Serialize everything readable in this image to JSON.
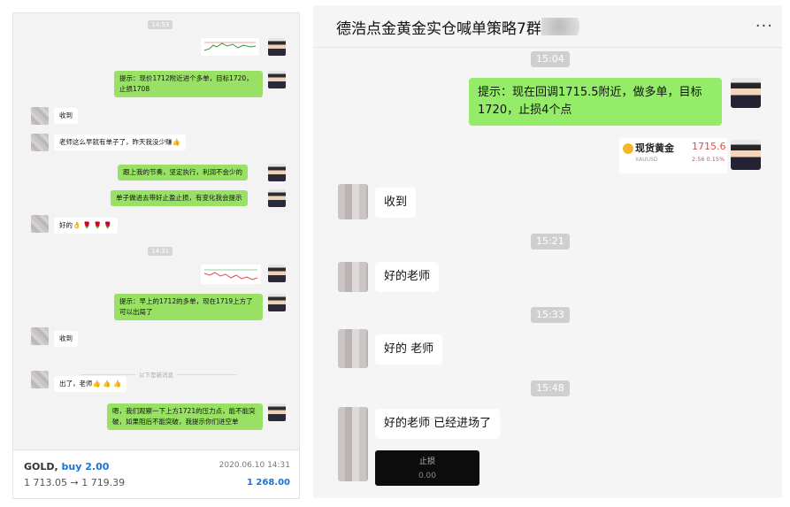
{
  "left_panel": {
    "time_1": "14:53",
    "msg_1": "提示：现价1712附近进个多单，目标1720，止损1708",
    "msg_2": "收到",
    "msg_3": "老师这么早就有单子了，昨天我没少赚👍",
    "msg_4": "跟上我的节奏，坚定执行，利润不会少的",
    "msg_5": "单子做进去带好止盈止损，有变化我会提示",
    "msg_6": "好的👌 🌹 🌹 🌹",
    "time_2": "14:31",
    "msg_7": "提示：早上的1712的多单，现在1719上方了可以出局了",
    "msg_8": "收到",
    "divider": "以下是新消息",
    "msg_9": "出了，老师👍 👍 👍",
    "msg_10": "嗯，我们观察一下上方1721的压力点，能不能突破，如果阻后不能突破，我提示你们进空单"
  },
  "trade_footer": {
    "symbol": "GOLD,",
    "action": "buy 2.00",
    "prices": "1 713.05 → 1 719.39",
    "datetime": "2020.06.10 14:31",
    "profit": "1 268.00"
  },
  "right_panel": {
    "title": "德浩点金黄金实仓喊单策略7群",
    "more": "...",
    "time_1": "15:04",
    "msg_1": "提示：现在回调1715.5附近，做多单，目标1720，止损4个点",
    "card": {
      "name": "现货黄金",
      "code": "XAUUSD",
      "price": "1715.6",
      "change": "2.56  0.15%"
    },
    "msg_2": "收到",
    "time_2": "15:21",
    "msg_3": "好的老师",
    "time_3": "15:33",
    "msg_4": "好的 老师",
    "time_4": "15:48",
    "msg_5": "好的老师 已经进场了",
    "stop_card": {
      "label": "止损",
      "value": "0.00"
    }
  },
  "colors": {
    "bubble_green": "#95ec69",
    "profit_blue": "#1a73d9",
    "gold_red": "#e24b4b"
  }
}
